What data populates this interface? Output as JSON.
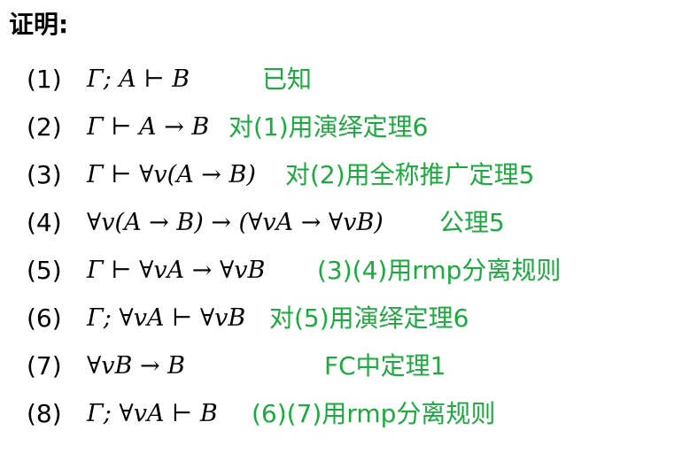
{
  "heading": "证明:",
  "accent_color": "#1aaa3e",
  "steps": [
    {
      "num": "(1)",
      "formula": "Γ; A ⊢ B",
      "reason": "已知"
    },
    {
      "num": "(2)",
      "formula": "Γ ⊢ A → B",
      "reason": "对(1)用演绎定理6"
    },
    {
      "num": "(3)",
      "formula": "Γ ⊢ ∀v(A → B)",
      "reason": "对(2)用全称推广定理5"
    },
    {
      "num": "(4)",
      "formula": "∀v(A → B) → (∀vA → ∀vB)",
      "reason": "公理5"
    },
    {
      "num": "(5)",
      "formula": "Γ ⊢ ∀vA → ∀vB",
      "reason": "(3)(4)用rmp分离规则"
    },
    {
      "num": "(6)",
      "formula": "Γ; ∀vA ⊢ ∀vB",
      "reason": "对(5)用演绎定理6"
    },
    {
      "num": "(7)",
      "formula": "∀vB → B",
      "reason": "FC中定理1"
    },
    {
      "num": "(8)",
      "formula": "Γ; ∀vA ⊢ B",
      "reason": "(6)(7)用rmp分离规则"
    }
  ]
}
